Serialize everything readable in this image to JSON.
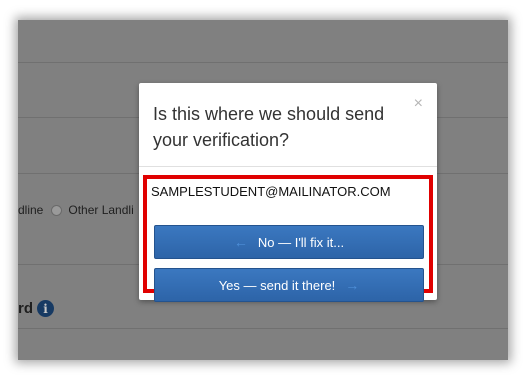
{
  "background": {
    "radio_row": {
      "text_prefix": "dline",
      "option_label": "Other Landli"
    },
    "field_label": "rd"
  },
  "modal": {
    "title": "Is this where we should send your verification?",
    "close_symbol": "×",
    "email": "SAMPLESTUDENT@MAILINATOR.COM",
    "no_button_label": "No — I'll fix it...",
    "yes_button_label": "Yes — send it there!"
  },
  "icons": {
    "close": "close-icon",
    "arrow_left": "arrow-left-icon",
    "arrow_right": "arrow-right-icon",
    "info": "info-icon"
  },
  "colors": {
    "highlight": "#e00000",
    "button": "#3270b6",
    "info_icon": "#173a63"
  }
}
